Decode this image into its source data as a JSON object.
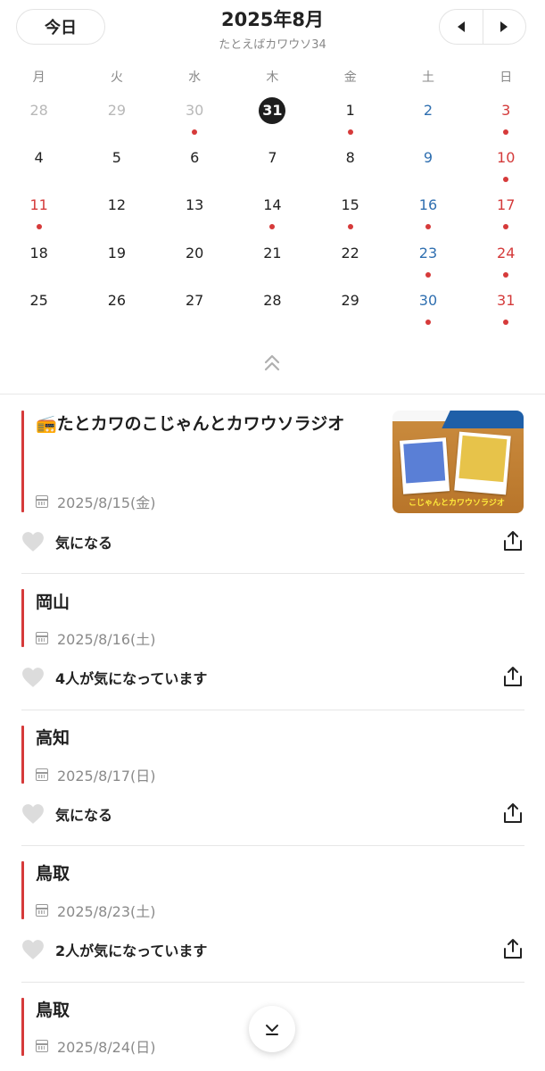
{
  "header": {
    "today_label": "今日",
    "month_title": "2025年8月",
    "subtitle": "たとえばカワウソ34",
    "prev_icon": "triangle-left-icon",
    "next_icon": "triangle-right-icon"
  },
  "calendar": {
    "weekdays": [
      "月",
      "火",
      "水",
      "木",
      "金",
      "土",
      "日"
    ],
    "weeks": [
      [
        "28",
        "29",
        "30",
        "31",
        "1",
        "2",
        "3"
      ],
      [
        "4",
        "5",
        "6",
        "7",
        "8",
        "9",
        "10"
      ],
      [
        "11",
        "12",
        "13",
        "14",
        "15",
        "16",
        "17"
      ],
      [
        "18",
        "19",
        "20",
        "21",
        "22",
        "23",
        "24"
      ],
      [
        "25",
        "26",
        "27",
        "28",
        "29",
        "30",
        "31"
      ]
    ],
    "today": "31",
    "event_marker_color": "#d63a3a"
  },
  "events": [
    {
      "icon": "📻",
      "title": "たとカワのこじゃんとカワウソラジオ",
      "date": "2025/8/15(金)",
      "interest": "気になる",
      "has_thumbnail": true
    },
    {
      "title": "岡山",
      "date": "2025/8/16(土)",
      "interest": "4人が気になっています"
    },
    {
      "title": "高知",
      "date": "2025/8/17(日)",
      "interest": "気になる"
    },
    {
      "title": "鳥取",
      "date": "2025/8/23(土)",
      "interest": "2人が気になっています"
    },
    {
      "title": "鳥取",
      "date": "2025/8/24(日)"
    }
  ],
  "thumbnail": {
    "caption": "こじゃんとカワウソラジオ"
  },
  "colors": {
    "accent": "#d63a3a",
    "saturday": "#2f6fb0",
    "sunday": "#d43a3a",
    "muted": "#b8b8b8"
  }
}
